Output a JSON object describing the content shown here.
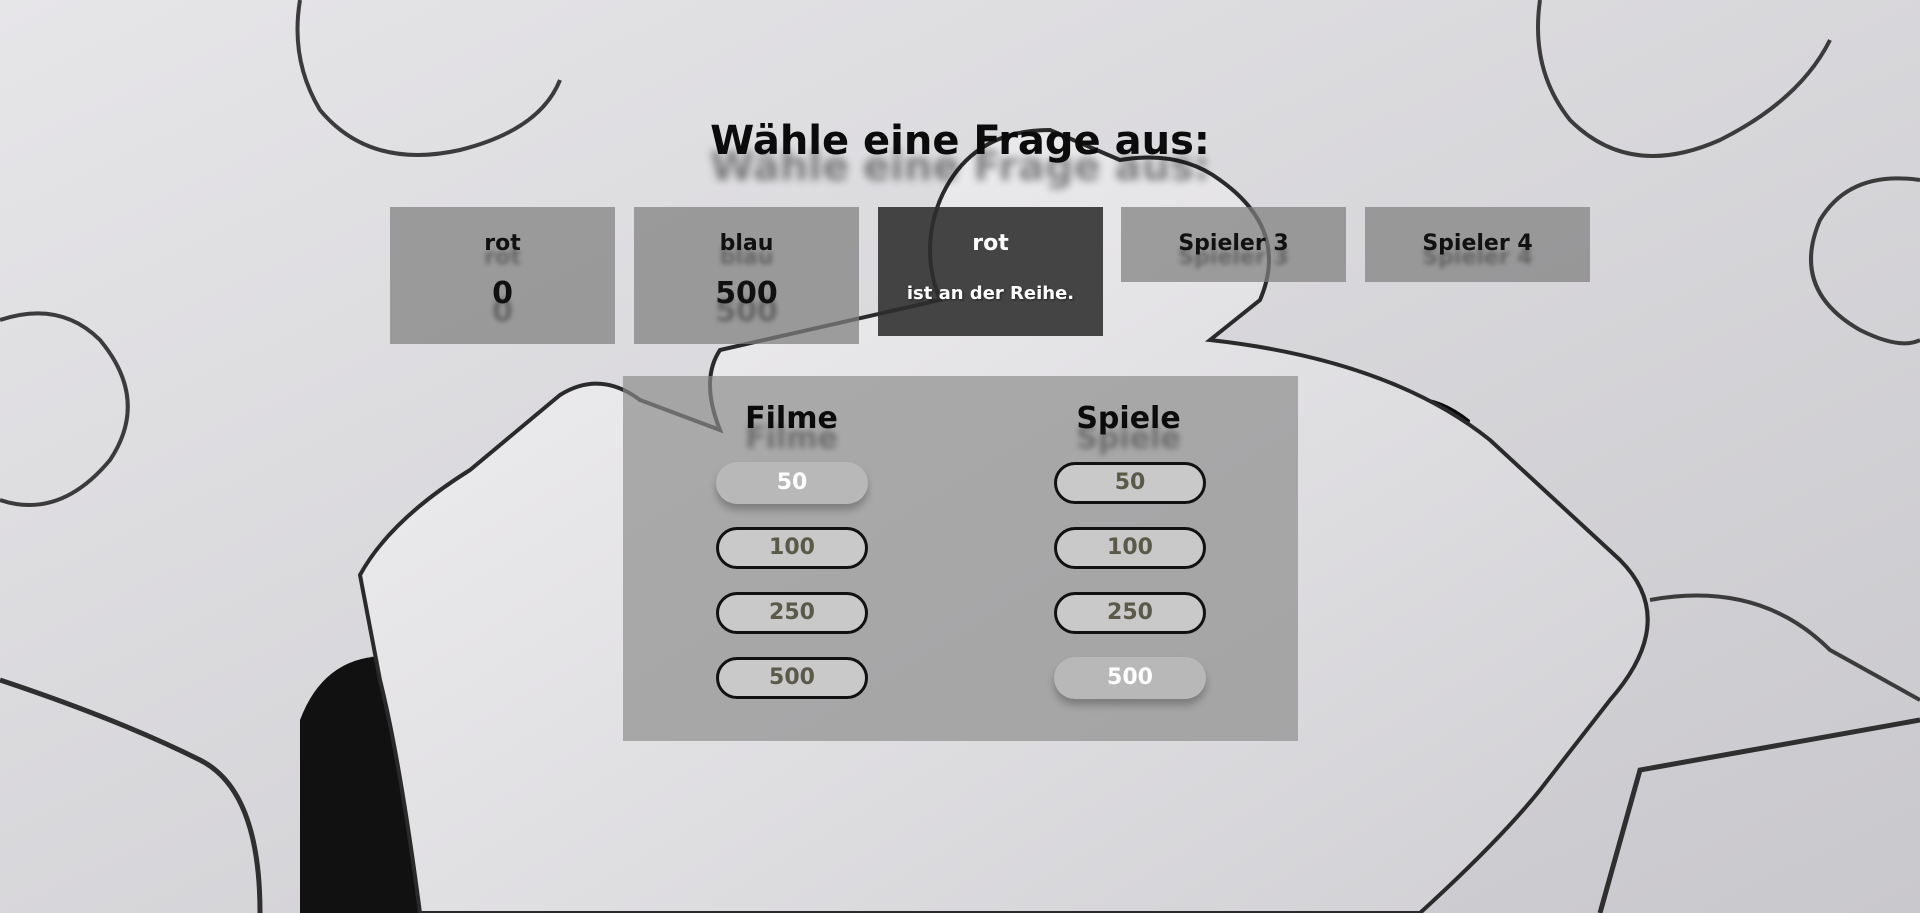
{
  "page": {
    "title": "Wähle eine Frage aus:"
  },
  "players": [
    {
      "name": "rot",
      "score": "0",
      "active": false
    },
    {
      "name": "blau",
      "score": "500",
      "active": false
    },
    {
      "name": "rot",
      "turn_text": "ist an der Reihe.",
      "active": true
    },
    {
      "name": "Spieler 3",
      "active": false
    },
    {
      "name": "Spieler 4",
      "active": false
    }
  ],
  "categories": [
    {
      "name": "Filme",
      "questions": [
        {
          "value": "50",
          "used": true
        },
        {
          "value": "100",
          "used": false
        },
        {
          "value": "250",
          "used": false
        },
        {
          "value": "500",
          "used": false
        }
      ]
    },
    {
      "name": "Spiele",
      "questions": [
        {
          "value": "50",
          "used": false
        },
        {
          "value": "100",
          "used": false
        },
        {
          "value": "250",
          "used": false
        },
        {
          "value": "500",
          "used": true
        }
      ]
    }
  ],
  "colors": {
    "active_player_bg": "#2d2d2d",
    "player_bg": "#808080",
    "button_bg": "#c9c9c9",
    "button_text": "#5b5a48",
    "used_button_text": "#ffffff"
  }
}
